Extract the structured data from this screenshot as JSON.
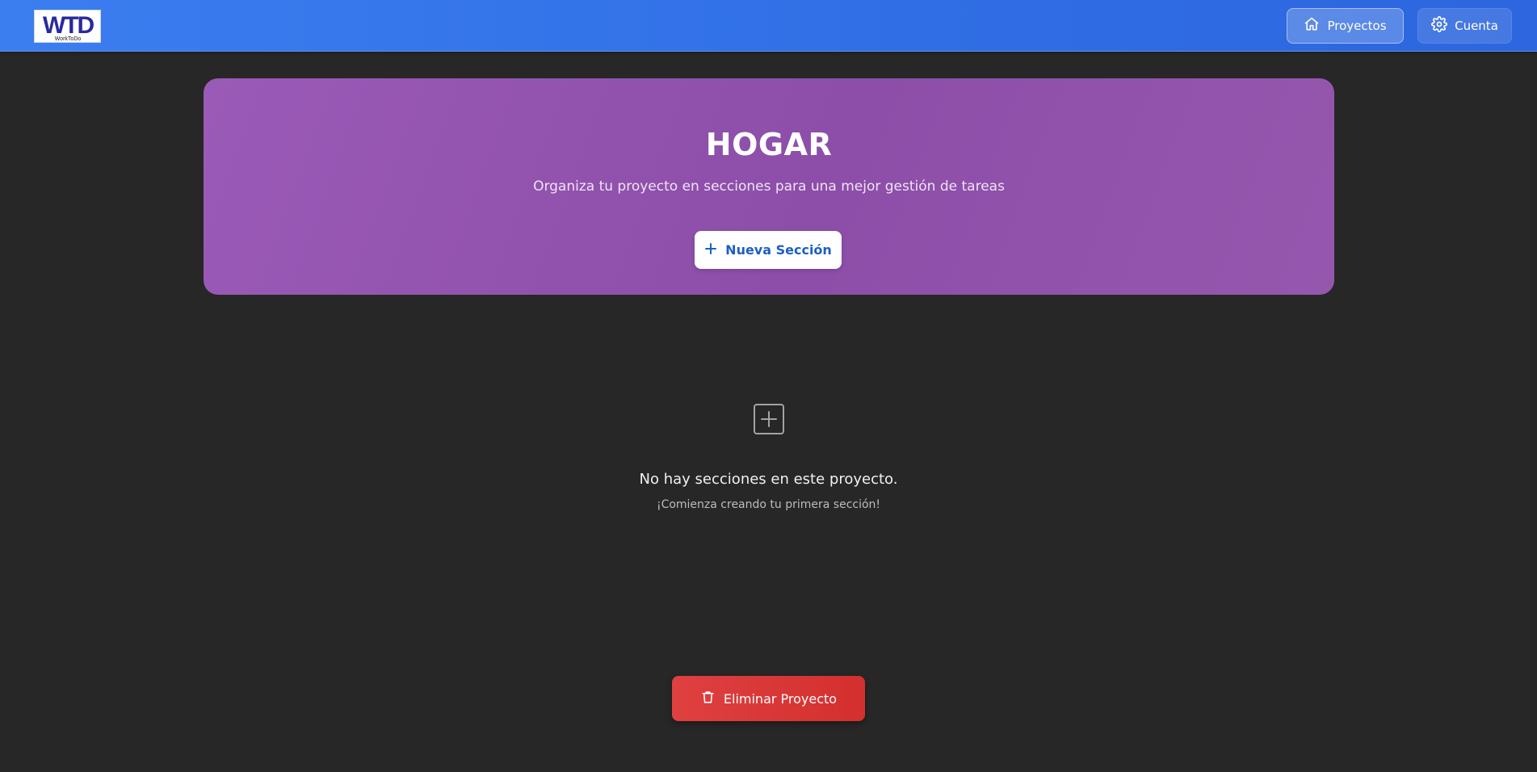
{
  "header": {
    "logo": {
      "text": "WTD",
      "tagline": "WorkToDo",
      "icon": "worktodo-logo"
    },
    "nav": [
      {
        "label": "Proyectos",
        "icon": "home-icon"
      },
      {
        "label": "Cuenta",
        "icon": "gear-icon"
      }
    ]
  },
  "hero": {
    "title": "HOGAR",
    "subtitle": "Organiza tu proyecto en secciones para una mejor gestión de tareas",
    "new_section_label": "Nueva Sección",
    "new_section_icon": "plus-icon"
  },
  "empty_state": {
    "icon": "plus-square-icon",
    "title": "No hay secciones en este proyecto.",
    "subtitle": "¡Comienza creando tu primera sección!"
  },
  "actions": {
    "delete_label": "Eliminar Proyecto",
    "delete_icon": "trash-icon"
  },
  "colors": {
    "navbar": "#306ee5",
    "hero": "#8c4ea8",
    "background": "#272727",
    "accent_text": "#1c5fc5",
    "danger": "#d42f2f"
  }
}
